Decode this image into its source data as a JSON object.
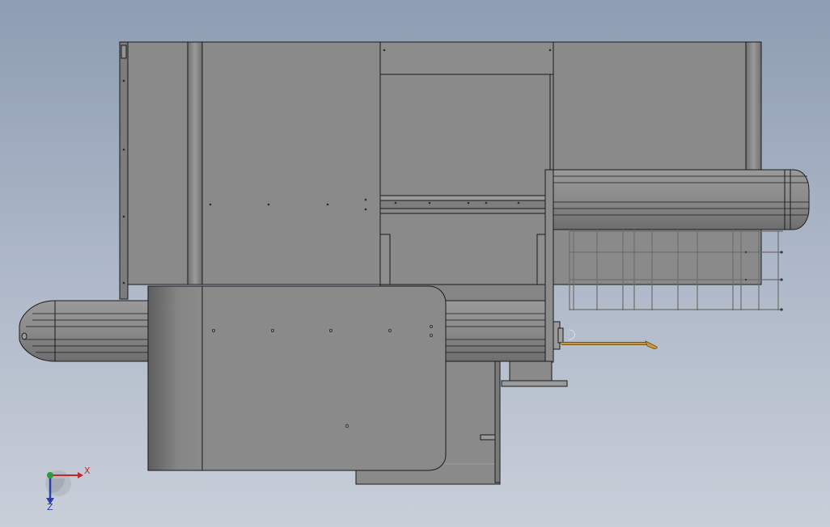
{
  "view": {
    "background_top": "#8e9db2",
    "background_bottom": "#c9cfd9",
    "part_fill": "#8a8a8a",
    "edge_color": "#1a1a1a",
    "rod_color": "#c89a3c"
  },
  "triad": {
    "x_label": "X",
    "z_label": "Z",
    "x_color": "#c0282a",
    "y_color": "#2e9a3a",
    "z_color": "#2a3ea8"
  }
}
